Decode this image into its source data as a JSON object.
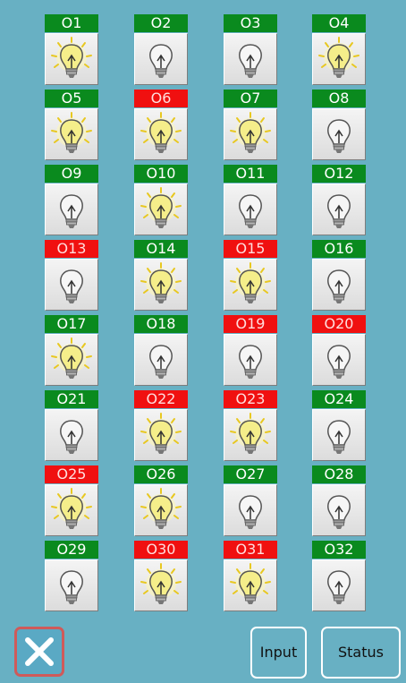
{
  "outputs": [
    {
      "label": "O1",
      "alarm": false,
      "lit": true
    },
    {
      "label": "O2",
      "alarm": false,
      "lit": false
    },
    {
      "label": "O3",
      "alarm": false,
      "lit": false
    },
    {
      "label": "O4",
      "alarm": false,
      "lit": true
    },
    {
      "label": "O5",
      "alarm": false,
      "lit": true
    },
    {
      "label": "O6",
      "alarm": true,
      "lit": true
    },
    {
      "label": "O7",
      "alarm": false,
      "lit": true
    },
    {
      "label": "O8",
      "alarm": false,
      "lit": false
    },
    {
      "label": "O9",
      "alarm": false,
      "lit": false
    },
    {
      "label": "O10",
      "alarm": false,
      "lit": true
    },
    {
      "label": "O11",
      "alarm": false,
      "lit": false
    },
    {
      "label": "O12",
      "alarm": false,
      "lit": false
    },
    {
      "label": "O13",
      "alarm": true,
      "lit": false
    },
    {
      "label": "O14",
      "alarm": false,
      "lit": true
    },
    {
      "label": "O15",
      "alarm": true,
      "lit": true
    },
    {
      "label": "O16",
      "alarm": false,
      "lit": false
    },
    {
      "label": "O17",
      "alarm": false,
      "lit": true
    },
    {
      "label": "O18",
      "alarm": false,
      "lit": false
    },
    {
      "label": "O19",
      "alarm": true,
      "lit": false
    },
    {
      "label": "O20",
      "alarm": true,
      "lit": false
    },
    {
      "label": "O21",
      "alarm": false,
      "lit": false
    },
    {
      "label": "O22",
      "alarm": true,
      "lit": true
    },
    {
      "label": "O23",
      "alarm": true,
      "lit": true
    },
    {
      "label": "O24",
      "alarm": false,
      "lit": false
    },
    {
      "label": "O25",
      "alarm": true,
      "lit": true
    },
    {
      "label": "O26",
      "alarm": false,
      "lit": true
    },
    {
      "label": "O27",
      "alarm": false,
      "lit": false
    },
    {
      "label": "O28",
      "alarm": false,
      "lit": false
    },
    {
      "label": "O29",
      "alarm": false,
      "lit": false
    },
    {
      "label": "O30",
      "alarm": true,
      "lit": true
    },
    {
      "label": "O31",
      "alarm": true,
      "lit": true
    },
    {
      "label": "O32",
      "alarm": false,
      "lit": false
    }
  ],
  "footer": {
    "close_icon": "close-icon",
    "input_label": "Input",
    "status_label": "Status"
  },
  "colors": {
    "background": "#68b0c3",
    "label_ok": "#0a8a1e",
    "label_alarm": "#f01010",
    "bulb_lit": "#f5ee8a"
  }
}
